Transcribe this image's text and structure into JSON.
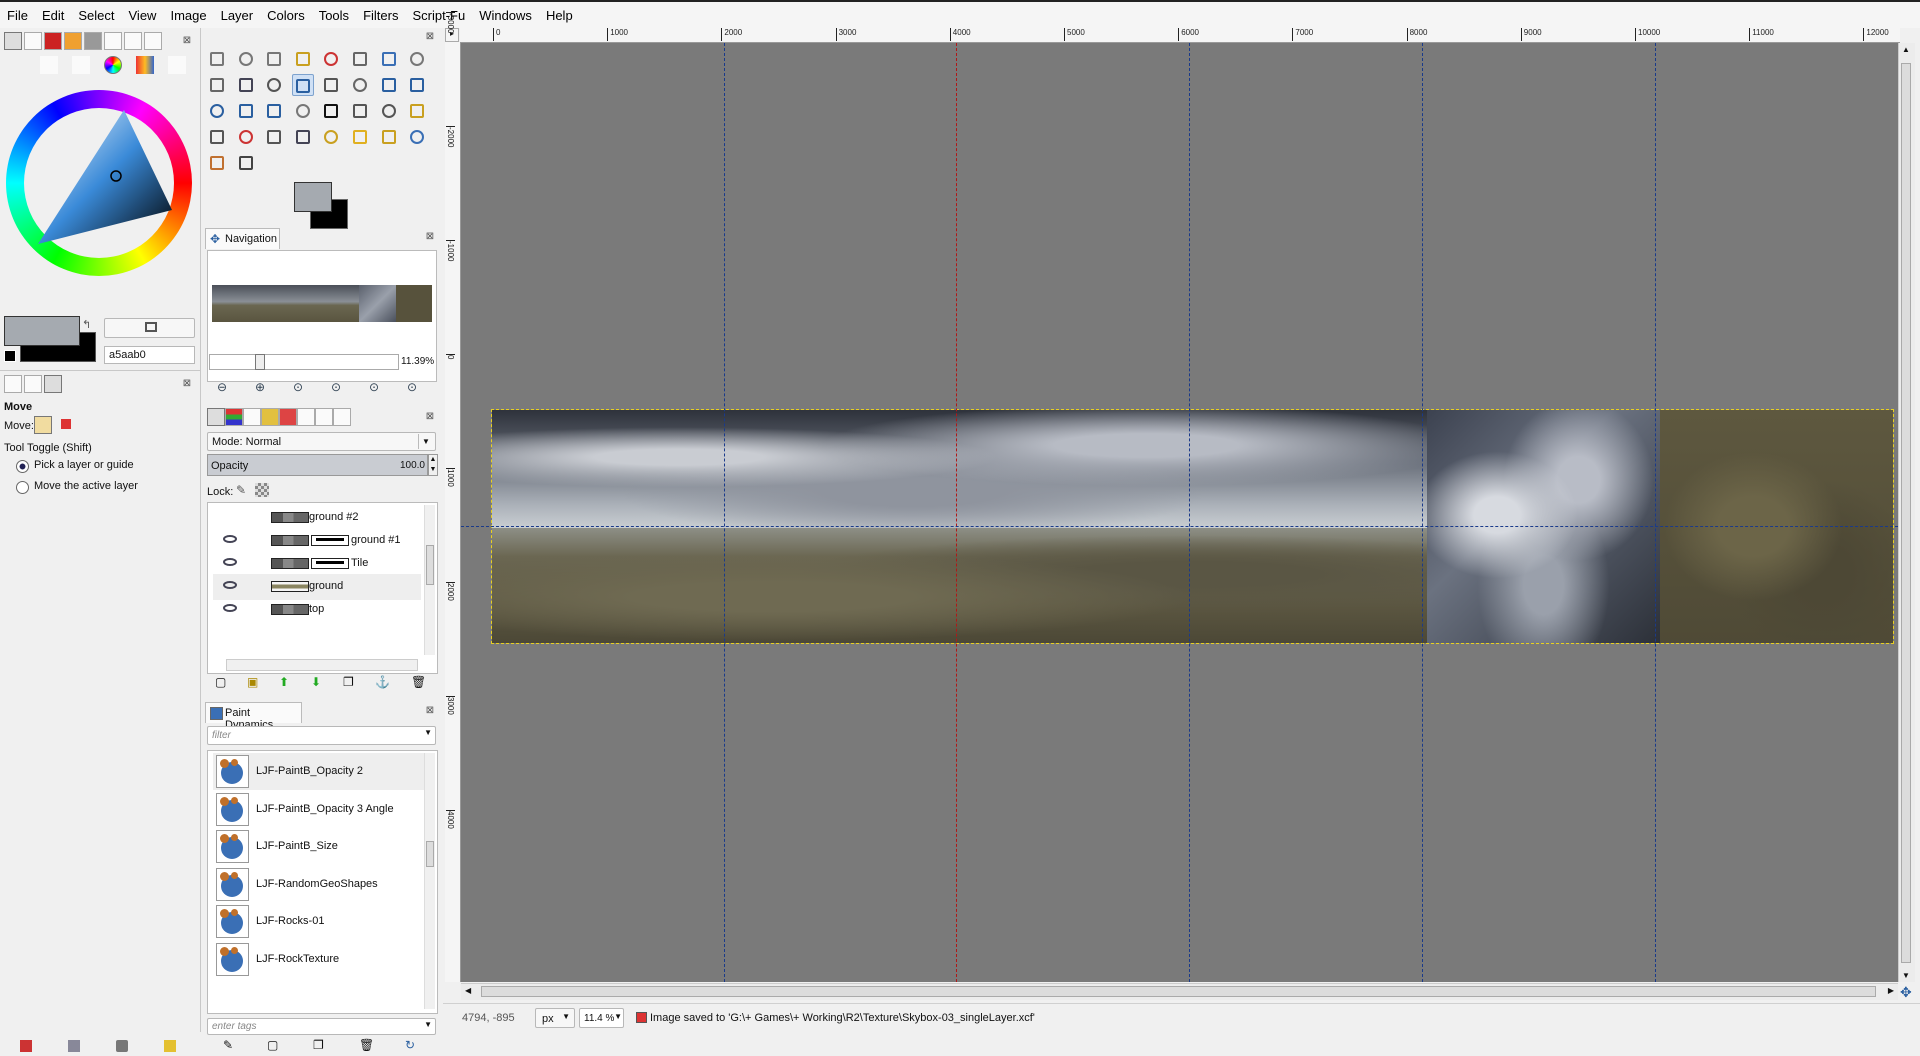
{
  "menu": [
    "File",
    "Edit",
    "Select",
    "View",
    "Image",
    "Layer",
    "Colors",
    "Tools",
    "Filters",
    "Script-Fu",
    "Windows",
    "Help"
  ],
  "colors": {
    "foreground": "#a5aab0",
    "background": "#000000",
    "hex_value": "a5aab0",
    "canvas_bg": "#7a7a7a",
    "guide": "#1a3a8a",
    "guide_red": "#b01818",
    "selection": "#e8d020"
  },
  "tool_options": {
    "title": "Move",
    "move_label": "Move:",
    "toggle_label": "Tool Toggle  (Shift)",
    "options": [
      "Pick a layer or guide",
      "Move the active layer"
    ],
    "selected": 0
  },
  "tools": [
    "rect-select",
    "ellipse-select",
    "free-select",
    "fuzzy-select",
    "select-by-color",
    "scissors",
    "foreground-select",
    "paths",
    "color-picker",
    "zoom",
    "measure",
    "move",
    "align",
    "crop",
    "rotate",
    "scale",
    "shear",
    "perspective",
    "flip",
    "cage",
    "text",
    "bucket-fill",
    "blend",
    "pencil",
    "paintbrush",
    "eraser",
    "airbrush",
    "ink",
    "clone",
    "heal",
    "perspective-clone",
    "blur",
    "smudge",
    "dodge-burn"
  ],
  "active_tool": "move",
  "navigation": {
    "tab_label": "Navigation",
    "zoom_percent": "11.39%",
    "zoom_fraction": 0.25
  },
  "layers": {
    "mode_label": "Mode: Normal",
    "opacity_label": "Opacity",
    "opacity_value": "100.0",
    "lock_label": "Lock:",
    "items": [
      {
        "name": "ground #2",
        "visible": false,
        "mask": false
      },
      {
        "name": "ground #1",
        "visible": true,
        "mask": true
      },
      {
        "name": "Tile",
        "visible": true,
        "mask": true
      },
      {
        "name": "ground",
        "visible": true,
        "mask": false
      },
      {
        "name": "top",
        "visible": true,
        "mask": false
      }
    ]
  },
  "paint_dynamics": {
    "tab_label": "Paint Dynamics",
    "filter_placeholder": "filter",
    "tags_placeholder": "enter tags",
    "items": [
      "LJF-PaintB_Opacity 2",
      "LJF-PaintB_Opacity 3 Angle",
      "LJF-PaintB_Size",
      "LJF-RandomGeoShapes",
      "LJF-Rocks-01",
      "LJF-RockTexture"
    ]
  },
  "rulers": {
    "h_labels": [
      "0",
      "1000",
      "2000",
      "3000",
      "4000",
      "5000",
      "6000",
      "7000",
      "8000",
      "9000",
      "10000",
      "11000",
      "12000"
    ],
    "v_labels": [
      "-3000",
      "-2000",
      "-1000",
      "0",
      "1000",
      "2000",
      "3000",
      "4000"
    ]
  },
  "status": {
    "coords": "4794, -895",
    "unit": "px",
    "zoom": "11.4 %",
    "message": "Image saved to 'G:\\+ Games\\+ Working\\R2\\Texture\\Skybox-03_singleLayer.xcf'"
  }
}
